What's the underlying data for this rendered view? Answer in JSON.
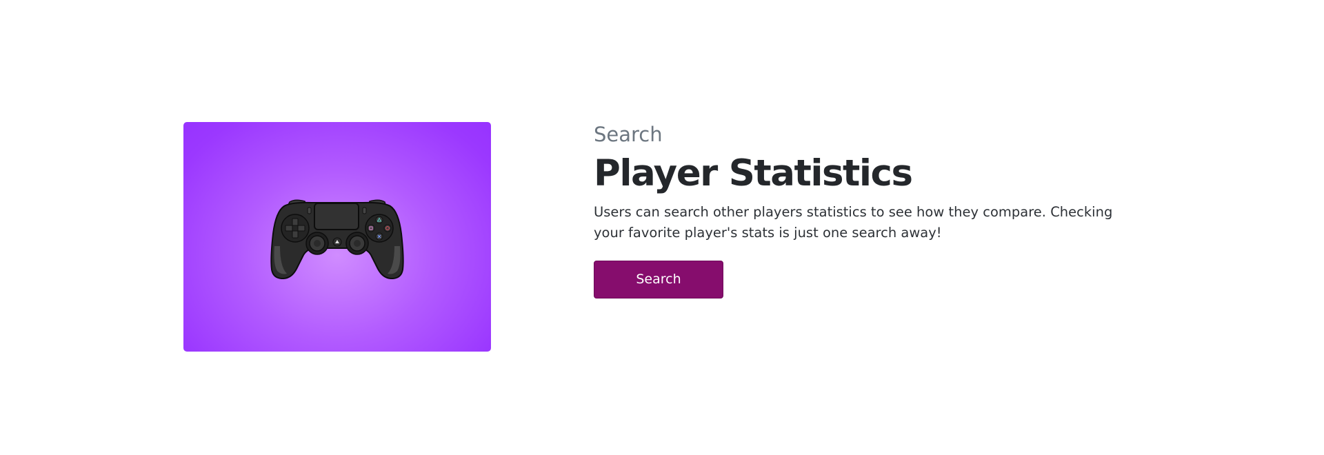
{
  "feature": {
    "eyebrow": "Search",
    "title": "Player Statistics",
    "description": "Users can search other players statistics to see how they compare. Checking your favorite player's stats is just one search away!",
    "button_label": "Search",
    "image_icon": "gamepad-icon"
  },
  "colors": {
    "button_background": "#860d6d",
    "card_gradient_center": "#d08cff",
    "card_gradient_edge": "#9733ff",
    "title_text": "#24272b",
    "eyebrow_text": "#6c7680"
  }
}
